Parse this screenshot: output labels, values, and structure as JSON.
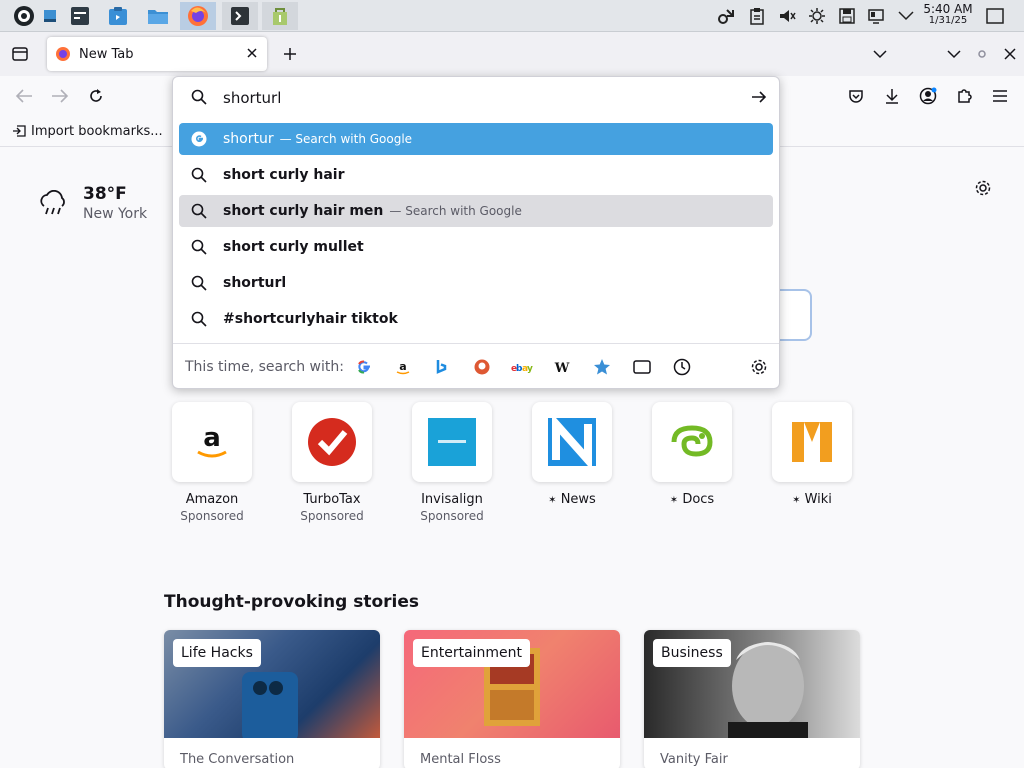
{
  "taskbar": {
    "apps": [
      {
        "name": "kde-menu-icon"
      },
      {
        "name": "pager-icon"
      },
      {
        "name": "system-monitor-icon"
      },
      {
        "name": "app-store-icon"
      },
      {
        "name": "file-manager-icon"
      },
      {
        "name": "firefox-icon"
      },
      {
        "name": "terminal-icon"
      },
      {
        "name": "package-installer-icon"
      }
    ],
    "clock": {
      "time": "5:40 AM",
      "date": "1/31/25"
    }
  },
  "browser": {
    "tab_title": "New Tab",
    "bookmarks": {
      "import_label": "Import bookmarks..."
    }
  },
  "urlbar": {
    "value": "shorturl",
    "suggestions": [
      {
        "text": "shortur",
        "desc": "— Search with Google",
        "state": "selected"
      },
      {
        "text": "short curly hair",
        "desc": "",
        "state": "normal"
      },
      {
        "text": "short curly hair men",
        "desc": "— Search with Google",
        "state": "hover"
      },
      {
        "text": "short curly mullet",
        "desc": "",
        "state": "normal"
      },
      {
        "text": "shorturl",
        "desc": "",
        "state": "normal"
      },
      {
        "text": "#shortcurlyhair tiktok",
        "desc": "",
        "state": "normal"
      }
    ],
    "search_with_label": "This time, search with:",
    "engines": [
      "G",
      "a",
      "b",
      "D",
      "ebay",
      "W"
    ]
  },
  "weather": {
    "temp": "38°F",
    "city": "New York"
  },
  "shortcuts": [
    {
      "name": "Amazon",
      "sub": "Sponsored"
    },
    {
      "name": "TurboTax",
      "sub": "Sponsored"
    },
    {
      "name": "Invisalign",
      "sub": "Sponsored"
    },
    {
      "name": "News",
      "sub": ""
    },
    {
      "name": "Docs",
      "sub": ""
    },
    {
      "name": "Wiki",
      "sub": ""
    }
  ],
  "stories": {
    "heading": "Thought-provoking stories",
    "cards": [
      {
        "tag": "Life Hacks",
        "source": "The Conversation"
      },
      {
        "tag": "Entertainment",
        "source": "Mental Floss"
      },
      {
        "tag": "Business",
        "source": "Vanity Fair"
      }
    ]
  },
  "colors": {
    "accent": "#45a1e0",
    "selected_text": "#ffffff",
    "hover": "#dcdce0"
  }
}
